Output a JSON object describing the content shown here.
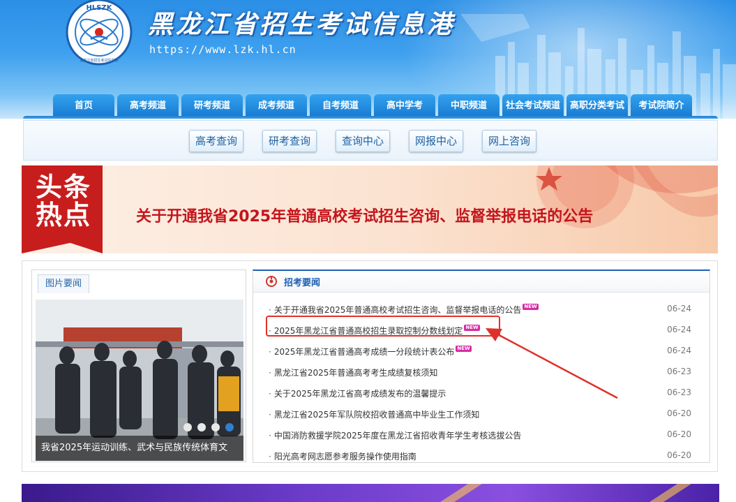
{
  "header": {
    "site_title": "黑龙江省招生考试信息港",
    "url": "https://www.lzk.hl.cn",
    "logo_top_text": "HLSZK",
    "logo_bottom_text": "黑龙江省招生考试信息港"
  },
  "nav": {
    "items": [
      {
        "label": "首页"
      },
      {
        "label": "高考频道"
      },
      {
        "label": "研考频道"
      },
      {
        "label": "成考频道"
      },
      {
        "label": "自考频道"
      },
      {
        "label": "高中学考"
      },
      {
        "label": "中职频道"
      },
      {
        "label": "社会考试频道"
      },
      {
        "label": "高职分类考试"
      },
      {
        "label": "考试院简介"
      }
    ]
  },
  "quick_links": [
    {
      "label": "高考查询"
    },
    {
      "label": "研考查询"
    },
    {
      "label": "查询中心"
    },
    {
      "label": "网报中心"
    },
    {
      "label": "网上咨询"
    }
  ],
  "headline": {
    "badge_line1": "头条",
    "badge_line2": "热点",
    "text": "关于开通我省2025年普通高校考试招生咨询、监督举报电话的公告"
  },
  "photo_news": {
    "tab_label": "图片要闻",
    "caption": "我省2025年运动训练、武术与民族传统体育文",
    "slides": 4,
    "active_slide": 4
  },
  "news": {
    "title": "招考要闻",
    "new_tag": "NEW",
    "items": [
      {
        "text": "关于开通我省2025年普通高校考试招生咨询、监督举报电话的公告",
        "date": "06-24",
        "is_new": true
      },
      {
        "text": "2025年黑龙江省普通高校招生录取控制分数线划定",
        "date": "06-24",
        "is_new": true
      },
      {
        "text": "2025年黑龙江省普通高考成绩一分段统计表公布",
        "date": "06-24",
        "is_new": true
      },
      {
        "text": "黑龙江省2025年普通高考考生成绩复核须知",
        "date": "06-23",
        "is_new": false
      },
      {
        "text": "关于2025年黑龙江省高考成绩发布的温馨提示",
        "date": "06-23",
        "is_new": false
      },
      {
        "text": "黑龙江省2025年军队院校招收普通高中毕业生工作须知",
        "date": "06-20",
        "is_new": false
      },
      {
        "text": "中国消防救援学院2025年度在黑龙江省招收青年学生考核选拔公告",
        "date": "06-20",
        "is_new": false
      },
      {
        "text": "阳光高考网志愿参考服务操作使用指南",
        "date": "06-20",
        "is_new": false
      }
    ]
  },
  "colors": {
    "header_blue": "#2b8fe6",
    "nav_blue": "#1679d0",
    "headline_red": "#c4151c",
    "highlight_red": "#e0302a",
    "new_tag": "#d72ba5"
  }
}
